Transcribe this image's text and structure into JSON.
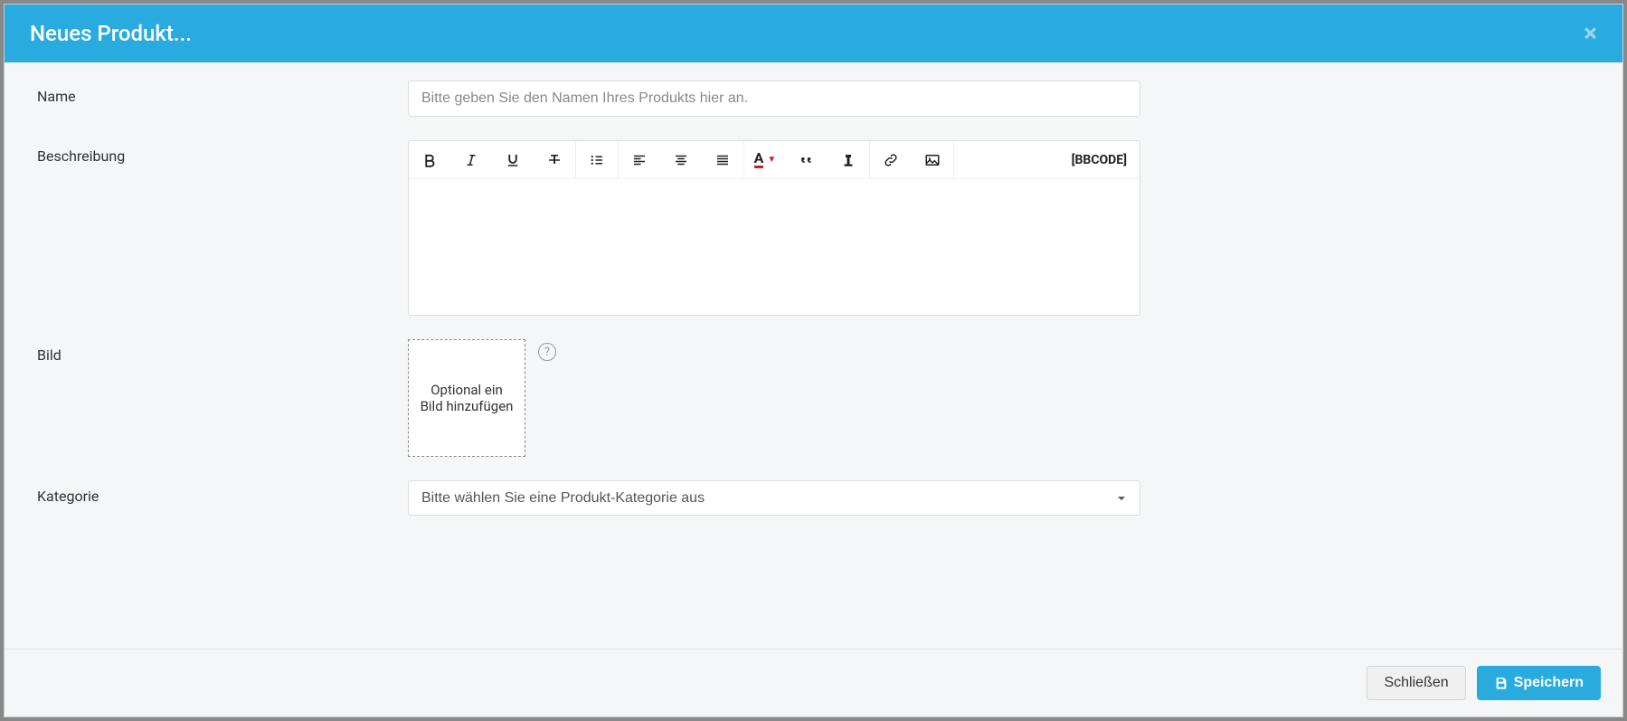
{
  "modal": {
    "title": "Neues Produkt...",
    "labels": {
      "name": "Name",
      "description": "Beschreibung",
      "image": "Bild",
      "category": "Kategorie"
    },
    "name_placeholder": "Bitte geben Sie den Namen Ihres Produkts hier an.",
    "image_upload_text": "Optional ein Bild hinzufügen",
    "category_placeholder": "Bitte wählen Sie eine Produkt-Kategorie aus",
    "bbcode_label": "[BBCODE]"
  },
  "toolbar": {
    "bold": "bold",
    "italic": "italic",
    "underline": "underline",
    "strike": "strikethrough",
    "list": "unordered-list",
    "align_left": "align-left",
    "align_center": "align-center",
    "align_justify": "align-justify",
    "font_color": "font-color",
    "quote": "quote",
    "unformat": "remove-format",
    "link": "link",
    "image": "image"
  },
  "footer": {
    "close": "Schließen",
    "save": "Speichern"
  }
}
